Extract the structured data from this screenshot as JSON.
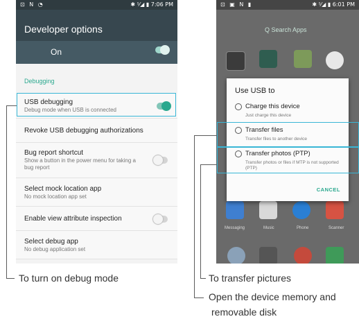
{
  "left_phone": {
    "status_icons": "⊡ N ◔",
    "status_right": "✱ ⁵⁄◢ ▮ 7:06 PM",
    "title": "Developer options",
    "master_toggle_label": "On",
    "section_header": "Debugging",
    "rows": [
      {
        "title": "USB debugging",
        "subtitle": "Debug mode when USB is connected",
        "toggle": "on"
      },
      {
        "title": "Revoke USB debugging authorizations",
        "subtitle": ""
      },
      {
        "title": "Bug report shortcut",
        "subtitle": "Show a button in the power menu for taking a bug report",
        "toggle": "off"
      },
      {
        "title": "Select mock location app",
        "subtitle": "No mock location app set"
      },
      {
        "title": "Enable view attribute inspection",
        "subtitle": "",
        "toggle": "off"
      },
      {
        "title": "Select debug app",
        "subtitle": "No debug application set"
      }
    ]
  },
  "right_phone": {
    "status_icons": "⊡ ▣ N ▮",
    "status_right": "✱ ⁵⁄◢ ▮ 6:01 PM",
    "search_label": "Q Search Apps",
    "dock_labels": [
      "Messaging",
      "Music",
      "Phone",
      "Scanner"
    ],
    "dialog": {
      "title": "Use USB to",
      "options": [
        {
          "title": "Charge this device",
          "subtitle": "Just charge this device"
        },
        {
          "title": "Transfer files",
          "subtitle": "Transfer files to another device"
        },
        {
          "title": "Transfer photos (PTP)",
          "subtitle": "Transfer photos or files if MTP is not supported (PTP)"
        }
      ],
      "cancel_label": "CANCEL"
    }
  },
  "captions": {
    "debug": "To turn on debug mode",
    "pictures": "To transfer pictures",
    "memory_line1": "Open the device memory and",
    "memory_line2": "removable disk"
  },
  "colors": {
    "accent": "#2aa88e",
    "callout": "#38b6d6",
    "header": "#37474f"
  }
}
